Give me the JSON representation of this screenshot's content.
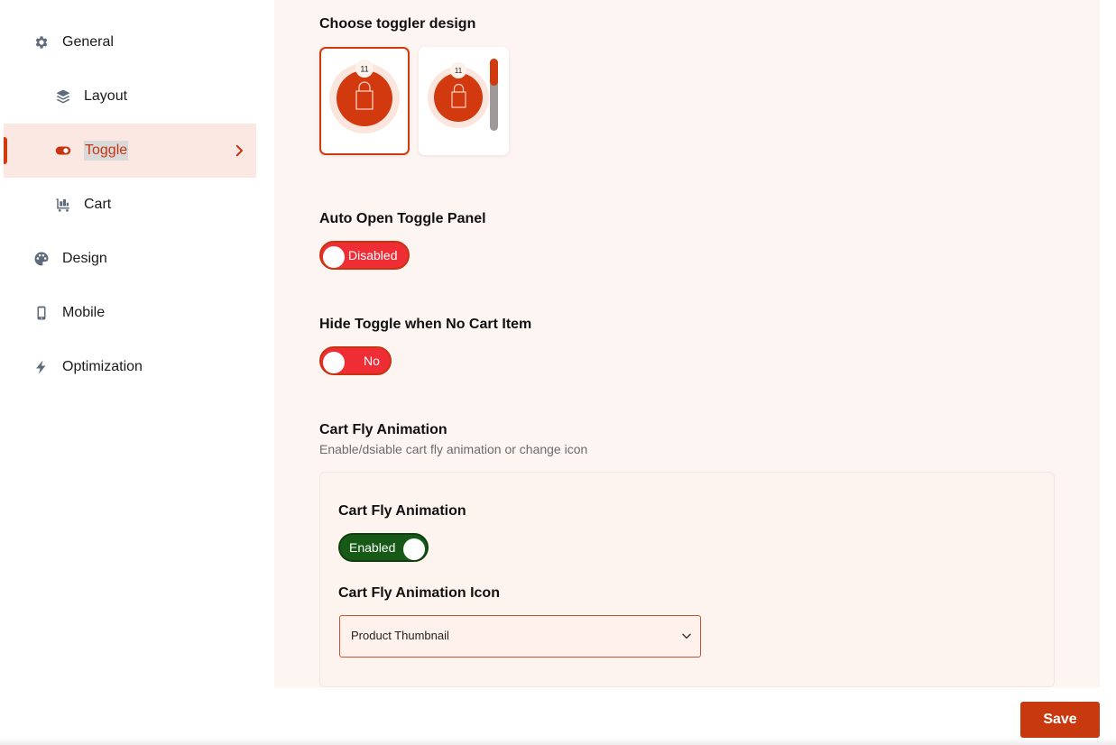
{
  "sidebar": {
    "items": [
      {
        "label": "General",
        "icon": "gear-icon"
      },
      {
        "label": "Layout",
        "icon": "layers-icon"
      },
      {
        "label": "Toggle",
        "icon": "toggle-icon",
        "active": true
      },
      {
        "label": "Cart",
        "icon": "cart-icon"
      },
      {
        "label": "Design",
        "icon": "palette-icon"
      },
      {
        "label": "Mobile",
        "icon": "mobile-icon"
      },
      {
        "label": "Optimization",
        "icon": "bolt-icon"
      }
    ]
  },
  "main": {
    "toggler_design": {
      "title": "Choose toggler design",
      "options": [
        {
          "badge_count": "11",
          "selected": true
        },
        {
          "badge_count": "11",
          "selected": false
        }
      ]
    },
    "auto_open": {
      "title": "Auto Open Toggle Panel",
      "state_label": "Disabled"
    },
    "hide_toggle": {
      "title": "Hide Toggle when No Cart Item",
      "state_label": "No"
    },
    "cart_fly": {
      "title": "Cart Fly Animation",
      "description": "Enable/dsiable cart fly animation or change icon",
      "inner_title": "Cart Fly Animation",
      "state_label": "Enabled",
      "icon_title": "Cart Fly Animation Icon",
      "icon_select_value": "Product Thumbnail"
    }
  },
  "footer": {
    "save_label": "Save"
  },
  "colors": {
    "accent": "#c8390f",
    "toggle_off": "#ee2d35",
    "toggle_on": "#175a17",
    "panel_bg": "#fdf5f2",
    "active_nav_bg": "#fbe8e2"
  }
}
